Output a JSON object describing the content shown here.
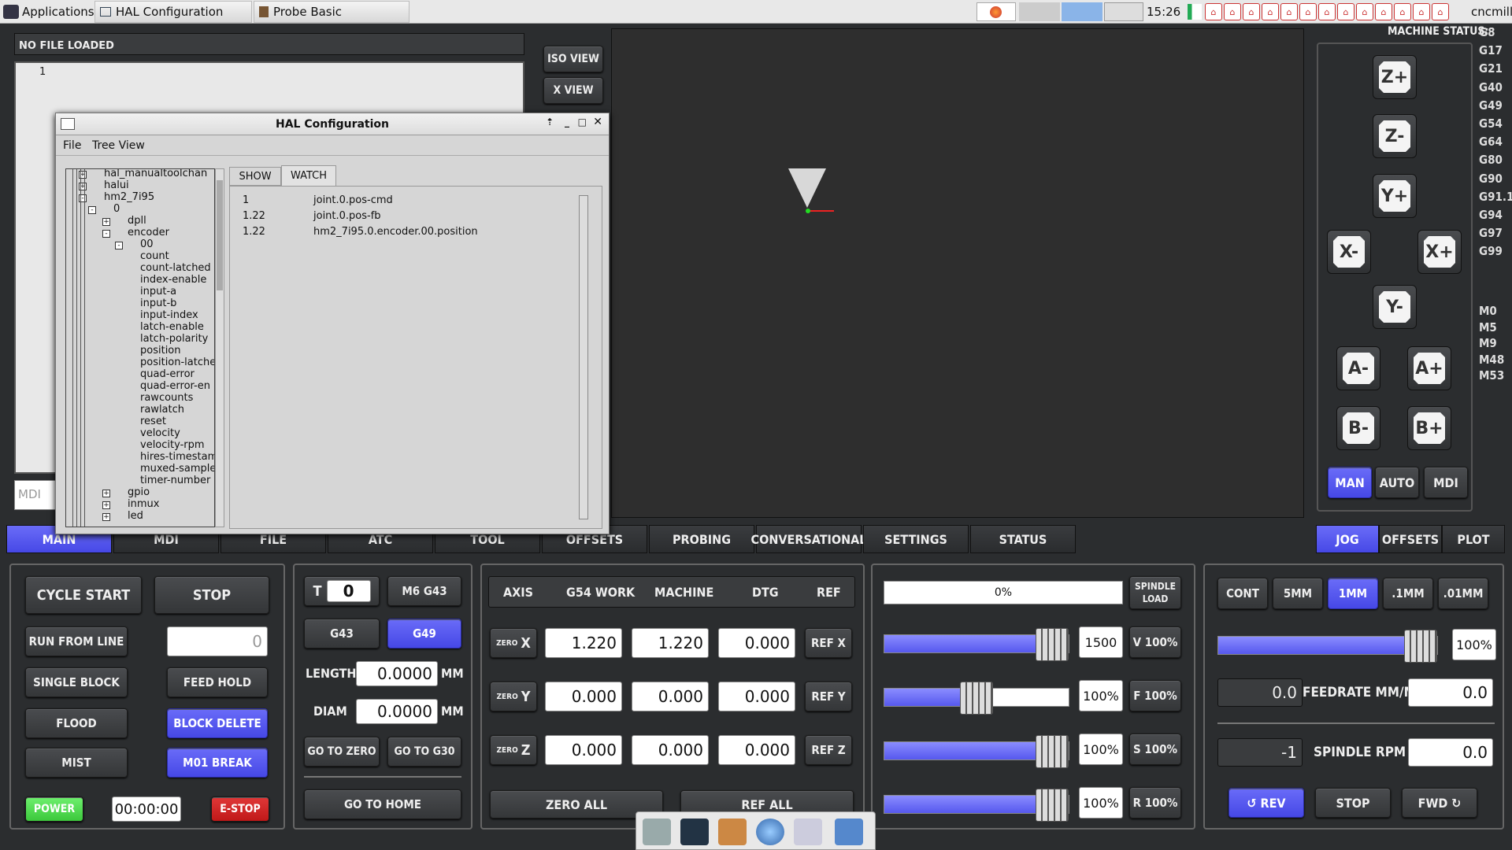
{
  "taskbar": {
    "apps_label": "Applications",
    "task1": "HAL Configuration",
    "task2": "Probe Basic",
    "clock": "15:26",
    "user": "cncmill"
  },
  "program": {
    "file_label": "NO FILE LOADED",
    "line1": "1",
    "mdi_placeholder": "MDI"
  },
  "views": {
    "iso": "ISO VIEW",
    "x": "X VIEW"
  },
  "status": {
    "label": "MACHINE STATUS:",
    "gcodes": [
      "G8",
      "G17",
      "G21",
      "G40",
      "G49",
      "G54",
      "G64",
      "G80",
      "G90",
      "G91.1",
      "G94",
      "G97",
      "G99"
    ],
    "mcodes": [
      "M0",
      "M5",
      "M9",
      "M48",
      "M53"
    ]
  },
  "jog_buttons": {
    "zp": "Z+",
    "zm": "Z-",
    "yp": "Y+",
    "xm": "X-",
    "xp": "X+",
    "ym": "Y-",
    "am": "A-",
    "ap": "A+",
    "bm": "B-",
    "bp": "B+"
  },
  "modes": {
    "man": "MAN",
    "auto": "AUTO",
    "mdi": "MDI"
  },
  "hal": {
    "title": "HAL Configuration",
    "menu": [
      "File",
      "Tree View"
    ],
    "tabs": [
      "SHOW",
      "WATCH"
    ],
    "tree": [
      "hal_manualtoolchan",
      "halui",
      "hm2_7i95",
      "0",
      "dpll",
      "encoder",
      "00",
      "count",
      "count-latched",
      "index-enable",
      "input-a",
      "input-b",
      "input-index",
      "latch-enable",
      "latch-polarity",
      "position",
      "position-latche",
      "quad-error",
      "quad-error-en",
      "rawcounts",
      "rawlatch",
      "reset",
      "velocity",
      "velocity-rpm",
      "hires-timestam",
      "muxed-sample-",
      "timer-number",
      "gpio",
      "inmux",
      "led"
    ],
    "watch": [
      {
        "val": "1",
        "name": "joint.0.pos-cmd"
      },
      {
        "val": "1.22",
        "name": "joint.0.pos-fb"
      },
      {
        "val": "1.22",
        "name": "hm2_7i95.0.encoder.00.position"
      }
    ]
  },
  "main_tabs": [
    "MAIN",
    "MDI",
    "FILE",
    "ATC",
    "TOOL",
    "OFFSETS",
    "PROBING",
    "CONVERSATIONAL",
    "SETTINGS",
    "STATUS"
  ],
  "right_tabs": [
    "JOG",
    "OFFSETS",
    "PLOT"
  ],
  "controls": {
    "cycle_start": "CYCLE START",
    "stop": "STOP",
    "run_from_line": "RUN FROM LINE",
    "run_line_val": "0",
    "single_block": "SINGLE BLOCK",
    "feed_hold": "FEED HOLD",
    "flood": "FLOOD",
    "block_delete": "BLOCK DELETE",
    "mist": "MIST",
    "m01_break": "M01 BREAK",
    "power": "POWER",
    "timer": "00:00:00",
    "estop": "E-STOP"
  },
  "tool": {
    "t_label": "T",
    "t_val": "0",
    "m6g43": "M6 G43",
    "g43": "G43",
    "g49": "G49",
    "length_label": "LENGTH",
    "length_val": "0.0000",
    "diam_label": "DIAM",
    "diam_val": "0.0000",
    "unit": "MM",
    "go_zero": "GO TO ZERO",
    "go_g30": "GO TO G30",
    "go_home": "GO TO HOME"
  },
  "dro": {
    "headers": [
      "AXIS",
      "G54 WORK",
      "MACHINE",
      "DTG",
      "REF"
    ],
    "zero_prefix": "ZERO",
    "rows": [
      {
        "axis": "X",
        "work": "1.220",
        "machine": "1.220",
        "dtg": "0.000",
        "ref": "REF X"
      },
      {
        "axis": "Y",
        "work": "0.000",
        "machine": "0.000",
        "dtg": "0.000",
        "ref": "REF Y"
      },
      {
        "axis": "Z",
        "work": "0.000",
        "machine": "0.000",
        "dtg": "0.000",
        "ref": "REF Z"
      }
    ],
    "zero_all": "ZERO ALL",
    "ref_all": "REF ALL"
  },
  "overrides": {
    "load_pct": "0%",
    "load_fraction": 0.0,
    "spindle_load": "SPINDLE LOAD",
    "rows": [
      {
        "val": "1500",
        "btn": "V 100%",
        "fraction": 1.0
      },
      {
        "val": "100%",
        "btn": "F 100%",
        "fraction": 0.5
      },
      {
        "val": "100%",
        "btn": "S 100%",
        "fraction": 1.0
      },
      {
        "val": "100%",
        "btn": "R 100%",
        "fraction": 1.0
      }
    ]
  },
  "jogpanel": {
    "incs": [
      "CONT",
      "5MM",
      "1MM",
      ".1MM",
      ".01MM"
    ],
    "jog_pct": "100%",
    "jog_fraction": 1.0,
    "feed_val": "0.0",
    "feed_label": "FEEDRATE MM/M",
    "feed_set": "0.0",
    "rpm_val": "-1",
    "rpm_label": "SPINDLE RPM",
    "rpm_set": "0.0",
    "rev": "↺ REV",
    "stop": "STOP",
    "fwd": "FWD ↻"
  }
}
